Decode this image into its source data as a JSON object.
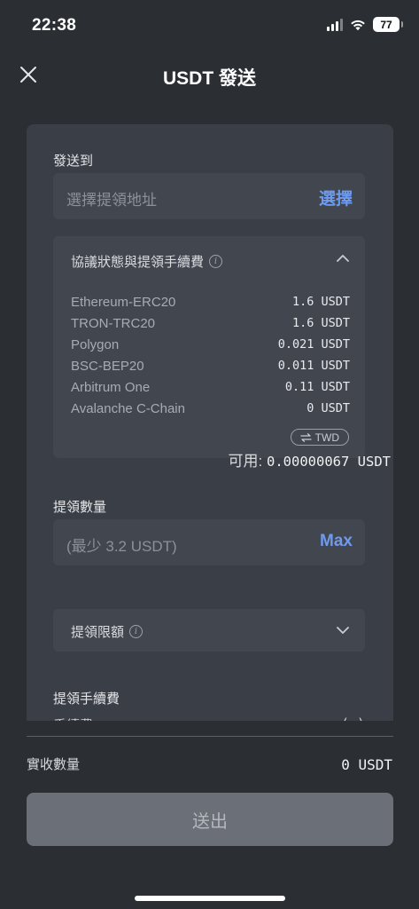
{
  "status_bar": {
    "time": "22:38",
    "battery": "77"
  },
  "header": {
    "title": "USDT 發送"
  },
  "send_to": {
    "label": "發送到",
    "placeholder": "選擇提領地址",
    "action": "選擇"
  },
  "fee_panel": {
    "title": "協議狀態與提領手續費",
    "networks": [
      {
        "name": "Ethereum-ERC20",
        "fee": "1.6 USDT"
      },
      {
        "name": "TRON-TRC20",
        "fee": "1.6 USDT"
      },
      {
        "name": "Polygon",
        "fee": "0.021 USDT"
      },
      {
        "name": "BSC-BEP20",
        "fee": "0.011 USDT"
      },
      {
        "name": "Arbitrum One",
        "fee": "0.11 USDT"
      },
      {
        "name": "Avalanche C-Chain",
        "fee": "0 USDT"
      }
    ],
    "currency_toggle": "TWD"
  },
  "amount": {
    "label": "提領數量",
    "placeholder": "(最少 3.2 USDT)",
    "max_label": "Max",
    "available_label": "可用:",
    "available_value": "0.00000067 USDT"
  },
  "limit": {
    "label": "提領限額"
  },
  "fee_section": {
    "label": "提領手續費"
  },
  "receive": {
    "label": "實收數量",
    "value": "0 USDT"
  },
  "submit": {
    "label": "送出"
  },
  "colors": {
    "accent": "#6e9bef",
    "background": "#2b2e33",
    "card": "#3a3e46"
  }
}
